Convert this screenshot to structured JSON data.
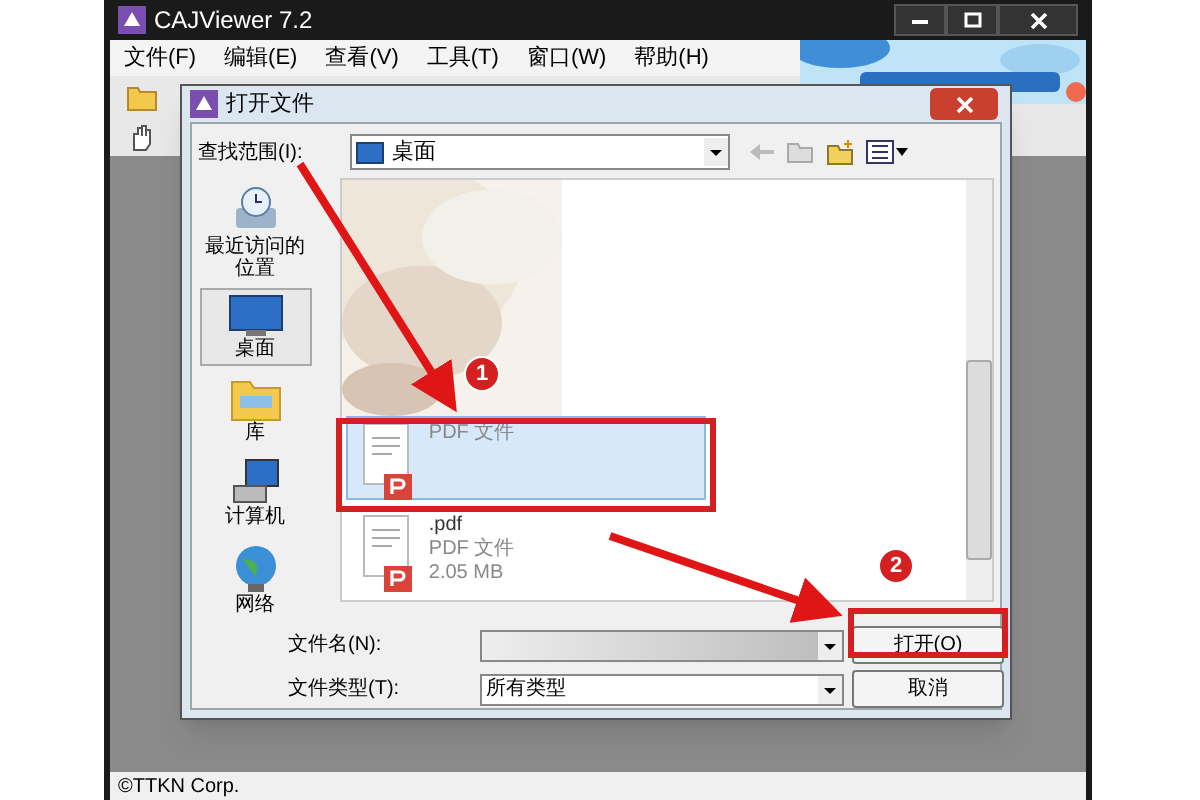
{
  "app": {
    "title": "CAJViewer 7.2",
    "menu": [
      "文件(F)",
      "编辑(E)",
      "查看(V)",
      "工具(T)",
      "窗口(W)",
      "帮助(H)"
    ],
    "banner": {
      "kind": "picture"
    },
    "status": "©TTKN Corp."
  },
  "dialog": {
    "title": "打开文件",
    "look_in_label": "查找范围(I):",
    "look_in_value": "桌面",
    "places": [
      {
        "label": "最近访问的位置",
        "kind": "recent",
        "selected": false
      },
      {
        "label": "桌面",
        "kind": "desktop",
        "selected": true
      },
      {
        "label": "库",
        "kind": "library",
        "selected": false
      },
      {
        "label": "计算机",
        "kind": "computer",
        "selected": false
      },
      {
        "label": "网络",
        "kind": "network",
        "selected": false
      }
    ],
    "files": [
      {
        "kind": "picture"
      },
      {
        "kind": "file",
        "type": "PDF 文件",
        "selected": true
      },
      {
        "kind": "file",
        "name": ".pdf",
        "type": "PDF 文件",
        "size": "2.05 MB",
        "selected": false
      }
    ],
    "filename_label": "文件名(N):",
    "filetype_label": "文件类型(T):",
    "filetype_value": "所有类型",
    "buttons": [
      "打开(O)",
      "取消"
    ]
  },
  "annotations": [
    {
      "label": "1"
    },
    {
      "label": "2"
    }
  ]
}
